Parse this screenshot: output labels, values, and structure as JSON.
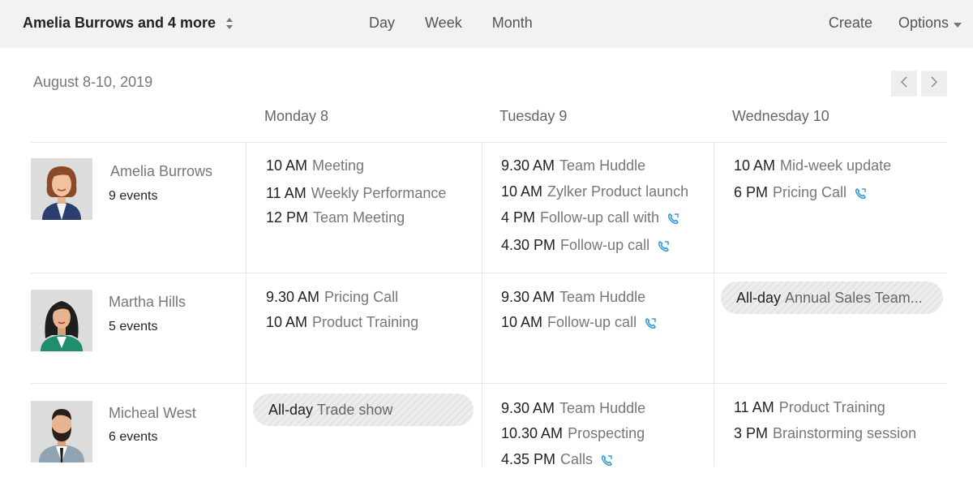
{
  "header": {
    "user_selector": "Amelia Burrows and 4 more",
    "tabs": [
      "Day",
      "Week",
      "Month"
    ],
    "create": "Create",
    "options": "Options"
  },
  "date_range": "August 8-10, 2019",
  "days": [
    "Monday 8",
    "Tuesday 9",
    "Wednesday 10"
  ],
  "people": [
    {
      "name": "Amelia Burrows",
      "count": "9 events",
      "monday": [
        {
          "time": "10 AM",
          "title": "Meeting"
        },
        {
          "time": "11 AM",
          "title": "Weekly Performance"
        },
        {
          "time": "12 PM",
          "title": "Team Meeting"
        }
      ],
      "tuesday": [
        {
          "time": "9.30 AM",
          "title": "Team Huddle"
        },
        {
          "time": "10 AM",
          "title": "Zylker Product launch"
        },
        {
          "time": "4 PM",
          "title": "Follow-up call with"
        },
        {
          "time": "4.30 PM",
          "title": "Follow-up call"
        }
      ],
      "wednesday": [
        {
          "time": "10 AM",
          "title": "Mid-week update"
        },
        {
          "time": "6 PM",
          "title": "Pricing Call"
        }
      ]
    },
    {
      "name": "Martha Hills",
      "count": "5 events",
      "monday": [
        {
          "time": "9.30 AM",
          "title": "Pricing Call"
        },
        {
          "time": "10 AM",
          "title": "Product Training"
        }
      ],
      "tuesday": [
        {
          "time": "9.30 AM",
          "title": "Team Huddle"
        },
        {
          "time": "10 AM",
          "title": "Follow-up call"
        }
      ],
      "wednesday": [
        {
          "time": "All-day",
          "title": "Annual Sales Team..."
        }
      ]
    },
    {
      "name": "Micheal West",
      "count": "6 events",
      "monday": [
        {
          "time": "All-day",
          "title": "Trade show"
        }
      ],
      "tuesday": [
        {
          "time": "9.30 AM",
          "title": "Team Huddle"
        },
        {
          "time": "10.30 AM",
          "title": "Prospecting"
        },
        {
          "time": "4.35 PM",
          "title": "Calls"
        }
      ],
      "wednesday": [
        {
          "time": "11 AM",
          "title": "Product Training"
        },
        {
          "time": "3 PM",
          "title": "Brainstorming session"
        }
      ]
    }
  ],
  "icons": {
    "call": "phone-call-icon",
    "sort": "sort-updown-icon",
    "options_caret": "caret-down-icon",
    "prev": "chevron-left-icon",
    "next": "chevron-right-icon"
  },
  "colors": {
    "call_icon": "#3a9ad9",
    "topbar_bg": "#f2f2f2"
  }
}
